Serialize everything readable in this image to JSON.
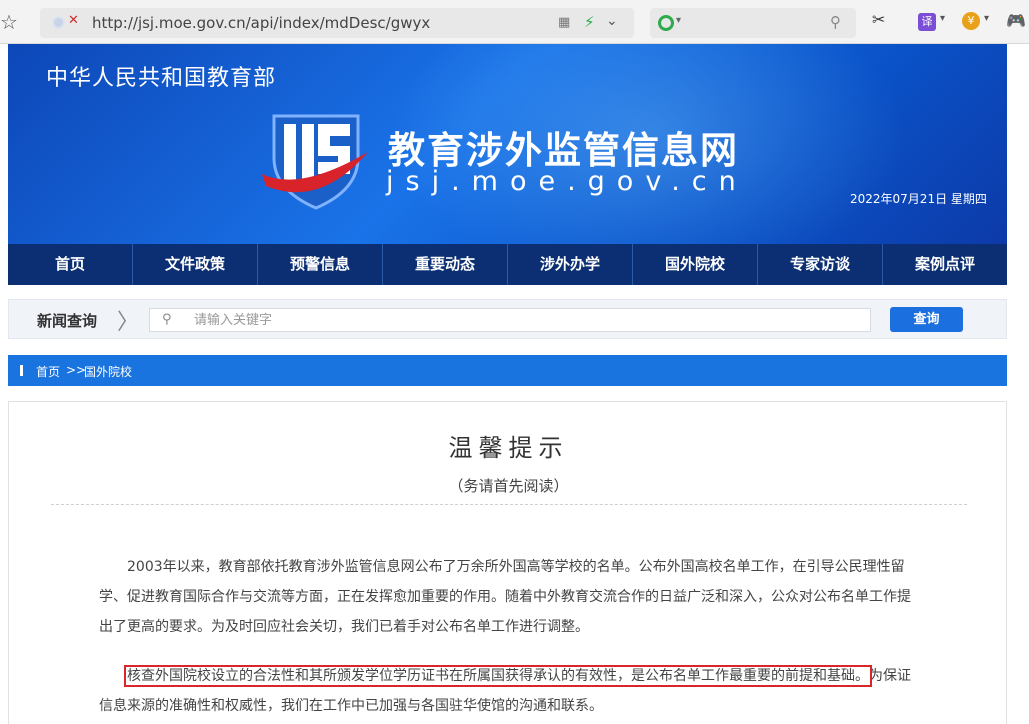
{
  "browser": {
    "url": "http://jsj.moe.gov.cn/api/index/mdDesc/gwyx",
    "translate_label": "译",
    "currency_label": "¥"
  },
  "header": {
    "ministry": "中华人民共和国教育部",
    "site_title": "教育涉外监管信息网",
    "domain": "jsj.moe.gov.cn",
    "date": "2022年07月21日  星期四"
  },
  "nav": {
    "items": [
      "首页",
      "文件政策",
      "预警信息",
      "重要动态",
      "涉外办学",
      "国外院校",
      "专家访谈",
      "案例点评"
    ]
  },
  "news_search": {
    "label": "新闻查询",
    "placeholder": "请输入关键字",
    "button": "查询"
  },
  "breadcrumb": {
    "home": "首页",
    "separator": ">>",
    "current": "国外院校"
  },
  "article": {
    "title": "温馨提示",
    "subtitle": "（务请首先阅读）",
    "para1": "2003年以来，教育部依托教育涉外监管信息网公布了万余所外国高等学校的名单。公布外国高校名单工作，在引导公民理性留学、促进教育国际合作与交流等方面，正在发挥愈加重要的作用。随着中外教育交流合作的日益广泛和深入，公众对公布名单工作提出了更高的要求。为及时回应社会关切，我们已着手对公布名单工作进行调整。",
    "para2_highlight": "核查外国院校设立的合法性和其所颁发学位学历证书在所属国获得承认的有效性，是公布名单工作最重要的前提和基础。",
    "para2_rest": "为保证信息来源的准确性和权威性，我们在工作中已加强与各国驻华使馆的沟通和联系。"
  },
  "colors": {
    "nav_bg": "#0b2f72",
    "banner_blue": "#1a73e8",
    "crumb_bg": "#1a74e0",
    "button_bg": "#1b6fde",
    "highlight_border": "#d9262a"
  }
}
